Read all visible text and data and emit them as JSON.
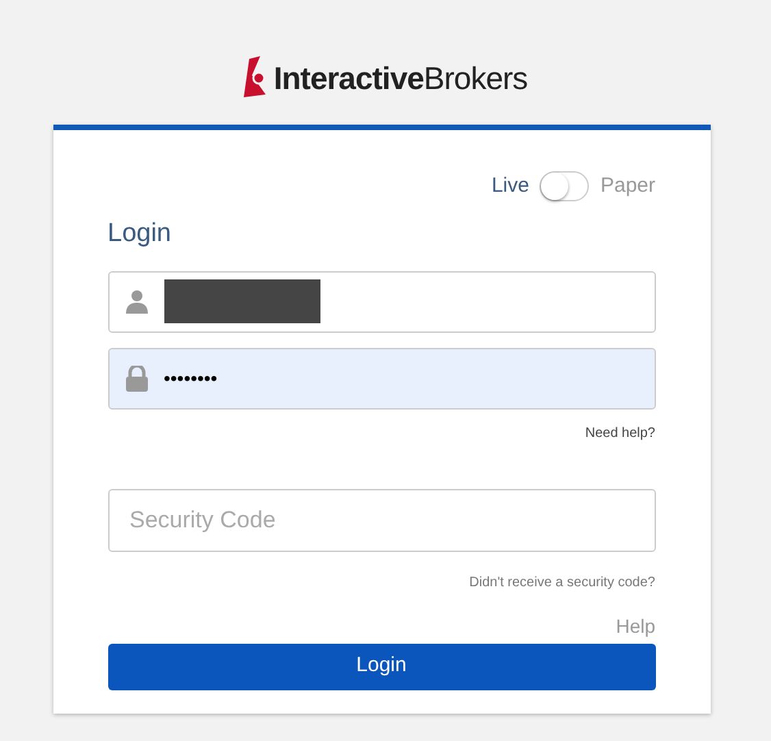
{
  "logo": {
    "text": "**Interactive**Brokers"
  },
  "mode_switch": {
    "left_label": "Live",
    "right_label": "Paper",
    "on": false
  },
  "form": {
    "title": "Login",
    "username": {
      "redacted": true
    },
    "password": {
      "value": "••••••••",
      "autofilled": true
    },
    "need_help": "Need help?",
    "security_code": {
      "placeholder": "Security Code"
    },
    "no_code_link": "Didn't receive a security code?",
    "help_link": "Help",
    "submit": "Login"
  }
}
